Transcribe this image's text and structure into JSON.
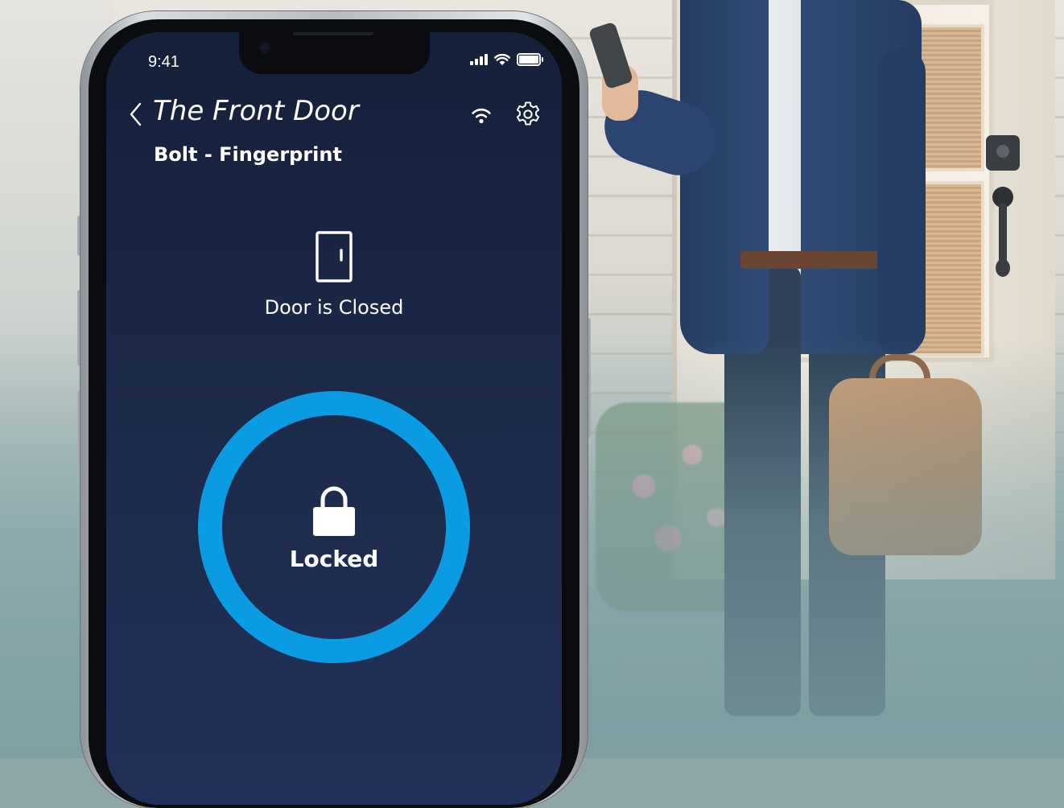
{
  "status_bar": {
    "time": "9:41"
  },
  "header": {
    "title": "The Front Door",
    "subtitle": "Bolt - Fingerprint",
    "back_icon": "chevron-left-icon",
    "connection_icon": "wifi-icon",
    "settings_icon": "gear-icon"
  },
  "door": {
    "status": "Door is Closed",
    "icon": "door-icon"
  },
  "lock": {
    "label": "Locked",
    "icon": "lock-icon",
    "ring_color": "#0a9be3"
  },
  "colors": {
    "screen_bg": "#1c2a4a",
    "accent": "#0a9be3",
    "text": "#ffffff"
  }
}
